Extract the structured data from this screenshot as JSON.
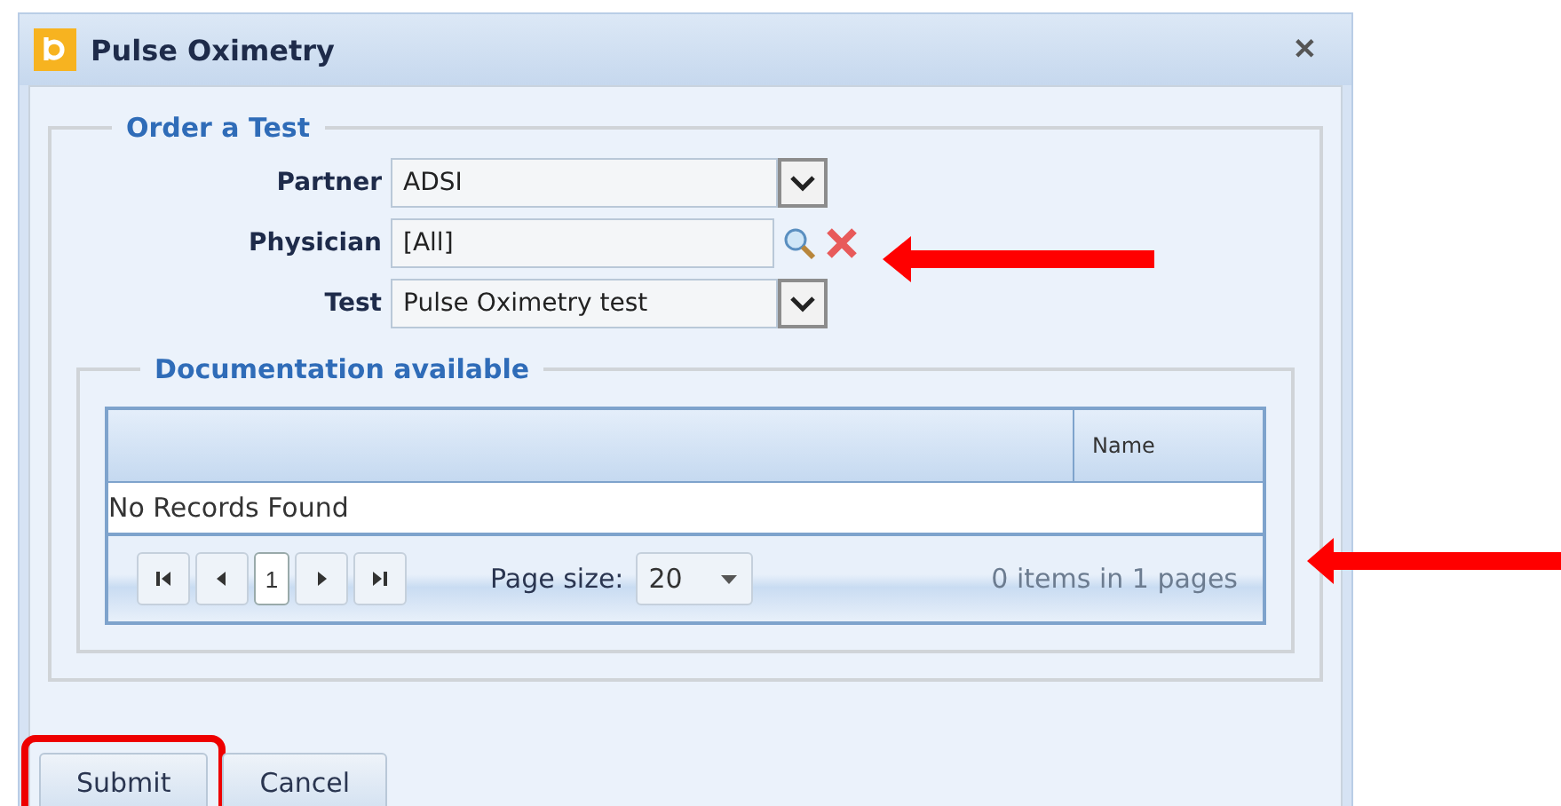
{
  "window": {
    "title": "Pulse Oximetry",
    "close": "✕"
  },
  "order_section": {
    "legend": "Order a Test",
    "fields": [
      {
        "kind": "dropdown",
        "label": "Partner",
        "value": "ADSI"
      },
      {
        "kind": "lookup",
        "label": "Physician",
        "value": "[All]"
      },
      {
        "kind": "dropdown",
        "label": "Test",
        "value": "Pulse Oximetry test"
      }
    ]
  },
  "documentation_section": {
    "legend": "Documentation available",
    "table": {
      "columns": [
        "Name"
      ],
      "empty_message": "No Records Found"
    },
    "pager": {
      "pages": [
        {
          "label": "1",
          "selected": true
        }
      ],
      "page_size_label": "Page size:",
      "page_size": "20",
      "summary": "0 items in 1 pages"
    }
  },
  "buttons": [
    {
      "label": "Submit",
      "highlighted": true
    },
    {
      "label": "Cancel",
      "highlighted": false
    }
  ]
}
